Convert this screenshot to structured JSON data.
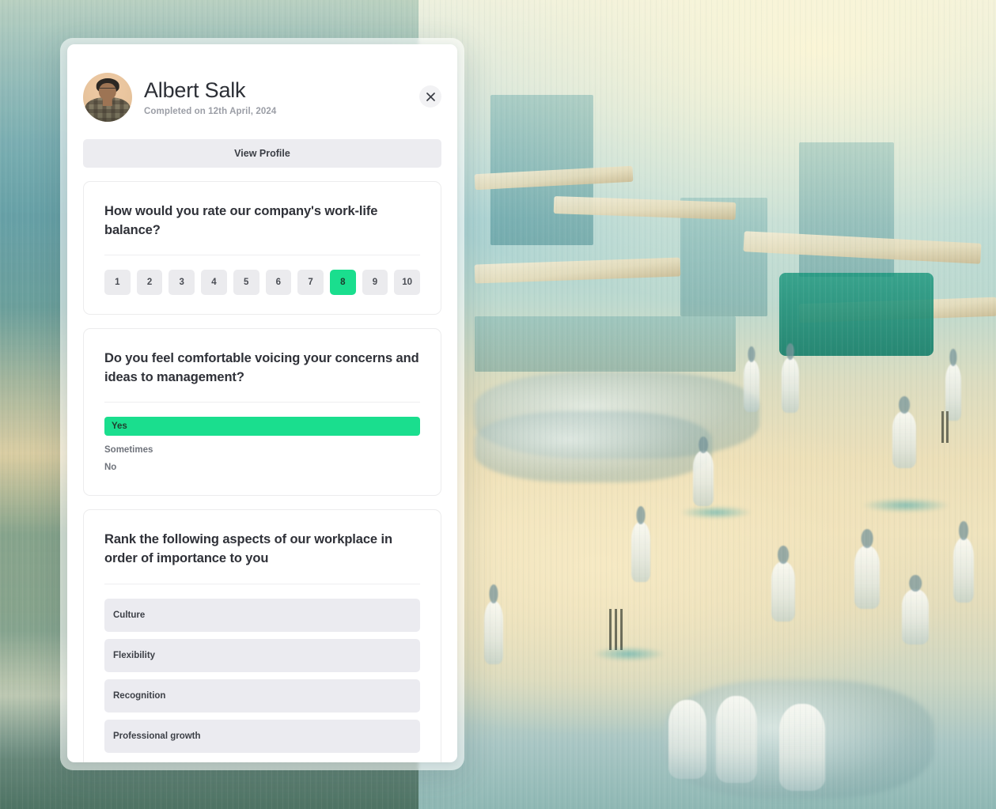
{
  "background": {
    "description": "impressionist-painting-cricket-match",
    "palette": [
      "#a8d2d4",
      "#efe3bd",
      "#1a8c8a",
      "#4a6848"
    ]
  },
  "modal": {
    "profile": {
      "name": "Albert Salk",
      "completed": "Completed on 12th April, 2024",
      "avatar_alt": "avatar",
      "close_icon": "close-icon",
      "view_profile_label": "View Profile"
    },
    "questions": [
      {
        "id": "work-life-balance",
        "type": "rating",
        "title": "How would you rate our company's work-life balance?",
        "options": [
          "1",
          "2",
          "3",
          "4",
          "5",
          "6",
          "7",
          "8",
          "9",
          "10"
        ],
        "selected": "8",
        "selected_color": "#1ade8e"
      },
      {
        "id": "voicing-concerns",
        "type": "choice",
        "title": "Do you feel comfortable voicing your concerns and ideas to management?",
        "options": [
          "Yes",
          "Sometimes",
          "No"
        ],
        "selected": "Yes",
        "selected_color": "#1ade8e"
      },
      {
        "id": "rank-workplace-aspects",
        "type": "rank",
        "title": "Rank the following aspects of our workplace in order of importance to you",
        "options": [
          "Culture",
          "Flexibility",
          "Recognition",
          "Professional growth"
        ]
      }
    ]
  }
}
